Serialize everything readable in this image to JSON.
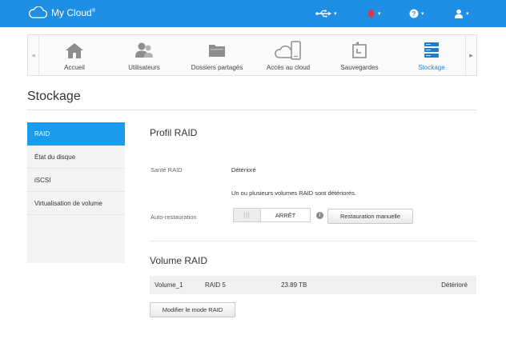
{
  "app": {
    "title": "My Cloud",
    "trademark": "®"
  },
  "topbar": {
    "usb_icon": "usb-icon",
    "alert_icon": "bell-alert-icon",
    "help_icon": "help-icon",
    "user_icon": "user-icon",
    "caret": "▾"
  },
  "nav": {
    "tabs": [
      {
        "label": "Accueil",
        "icon": "home-icon"
      },
      {
        "label": "Utilisateurs",
        "icon": "users-icon"
      },
      {
        "label": "Dossiers partagés",
        "icon": "folder-icon"
      },
      {
        "label": "Accès au cloud",
        "icon": "cloud-device-icon"
      },
      {
        "label": "Sauvegardes",
        "icon": "backup-icon"
      },
      {
        "label": "Stockage",
        "icon": "storage-icon",
        "active": true
      }
    ],
    "left_arrow": "◂",
    "right_arrow": "▸"
  },
  "page": {
    "title": "Stockage"
  },
  "sidebar": {
    "items": [
      {
        "label": "RAID",
        "active": true
      },
      {
        "label": "État du disque"
      },
      {
        "label": "iSCSI"
      },
      {
        "label": "Virtualisation de volume"
      }
    ]
  },
  "raid_profile": {
    "title": "Profil RAID",
    "health_label": "Santé RAID",
    "health_value": "Détérioré",
    "health_message": "Un ou plusieurs volumes RAID sont détériorés.",
    "auto_restore_label": "Auto-restauration",
    "toggle_grip": "|||",
    "toggle_state": "ARRÊT",
    "info_glyph": "i",
    "manual_restore_button": "Restauration manuelle"
  },
  "raid_volume": {
    "title": "Volume RAID",
    "rows": [
      {
        "name": "Volume_1",
        "raid": "RAID 5",
        "size": "23.89 TB",
        "status": "Détérioré"
      }
    ],
    "modify_button": "Modifier le mode RAID"
  },
  "colors": {
    "topbar": "#1f8fe6",
    "accent": "#1a9cec",
    "alert": "#e2343c"
  }
}
